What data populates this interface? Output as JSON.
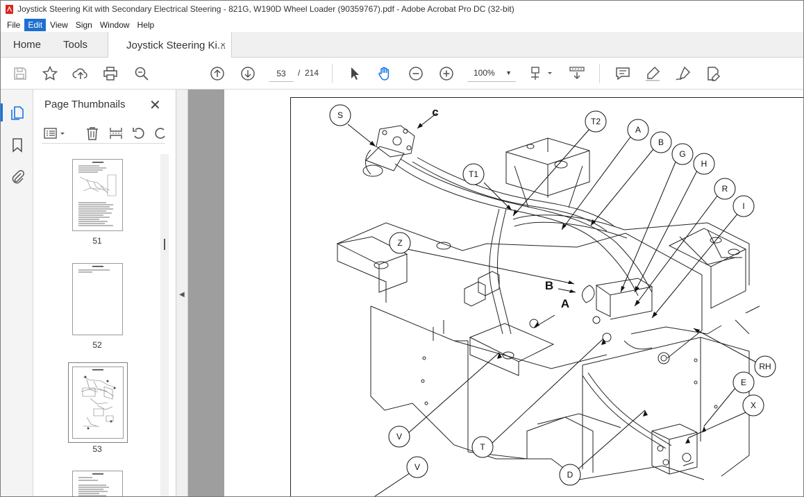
{
  "window": {
    "title": "Joystick Steering Kit with Secondary Electrical Steering - 821G, W190D Wheel Loader (90359767).pdf - Adobe Acrobat Pro DC (32-bit)"
  },
  "menu": [
    "File",
    "Edit",
    "View",
    "Sign",
    "Window",
    "Help"
  ],
  "tabs": {
    "home": "Home",
    "tools": "Tools",
    "document": "Joystick Steering Ki...",
    "close_glyph": "×"
  },
  "toolbar": {
    "current_page": "53",
    "page_separator": "/",
    "total_pages": "214",
    "zoom": "100%"
  },
  "thumbnails_panel": {
    "title": "Page Thumbnails",
    "close_glyph": "✕",
    "pages": [
      {
        "label": "51",
        "selected": false
      },
      {
        "label": "52",
        "selected": false
      },
      {
        "label": "53",
        "selected": true
      }
    ]
  },
  "diagram": {
    "callouts": [
      "S",
      "c",
      "T2",
      "A",
      "B",
      "G",
      "H",
      "T1",
      "R",
      "I",
      "Z",
      "B",
      "A",
      "RH",
      "E",
      "X",
      "V",
      "T",
      "D",
      "V"
    ]
  },
  "colors": {
    "accent": "#1473e6",
    "menu_highlight": "#1f6fd1",
    "gutter_gray": "#9e9e9e"
  }
}
